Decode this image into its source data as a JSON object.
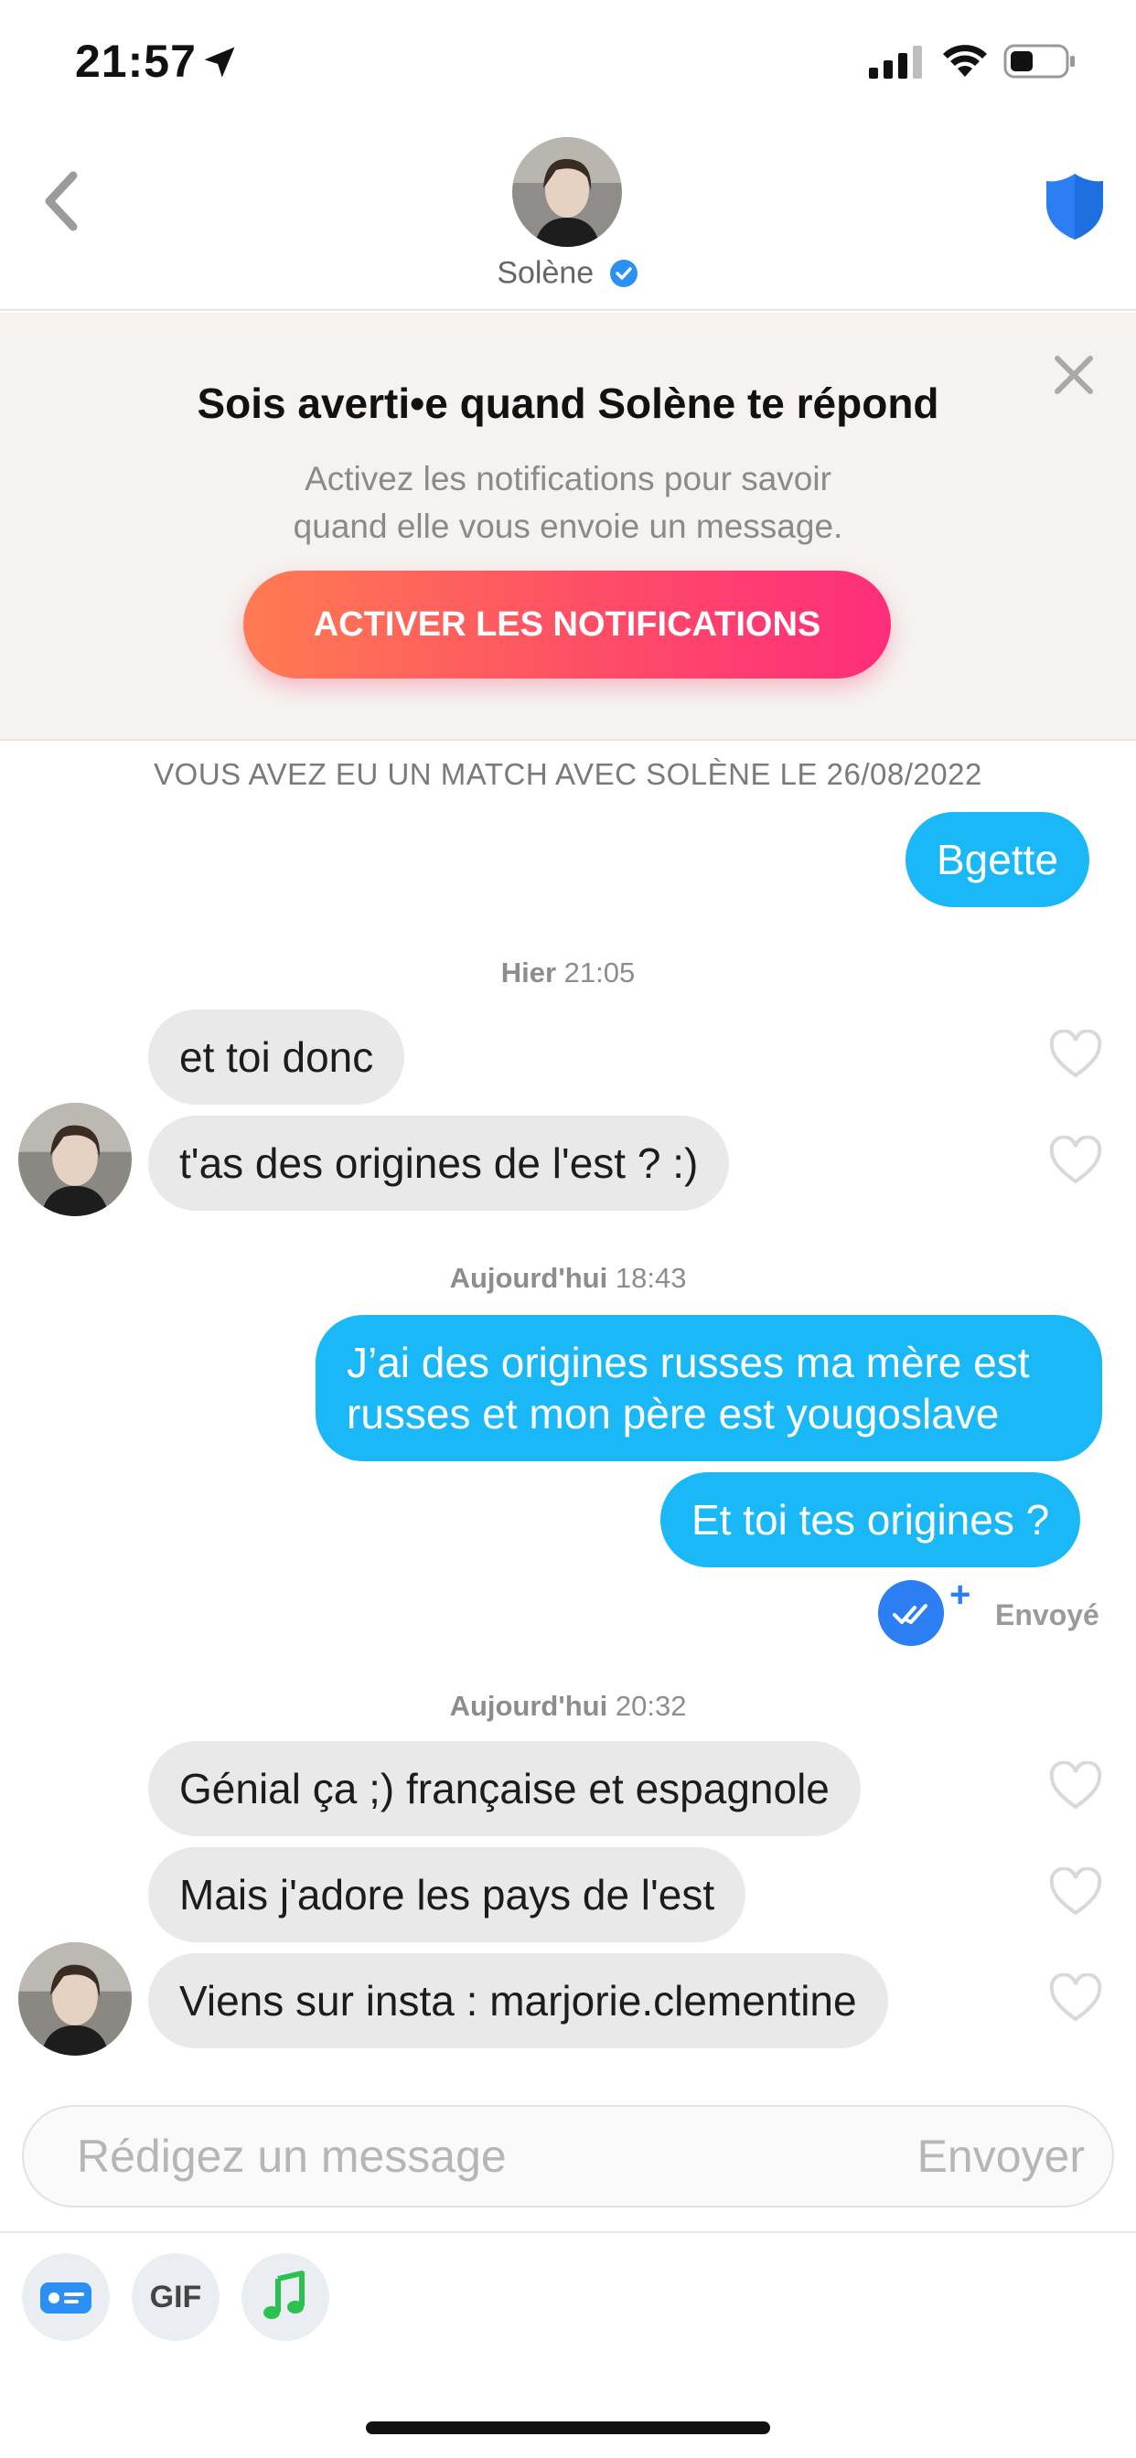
{
  "status_bar": {
    "time": "21:57"
  },
  "header": {
    "contact_name": "Solène"
  },
  "banner": {
    "title": "Sois averti•e quand Solène te répond",
    "subtitle_line1": "Activez les notifications pour savoir",
    "subtitle_line2": "quand elle vous envoie un message.",
    "button_label": "ACTIVER LES NOTIFICATIONS"
  },
  "chat": {
    "match_info": "VOUS AVEZ EU UN MATCH AVEC SOLÈNE LE 26/08/2022",
    "separators": [
      {
        "day": "Hier",
        "time": "21:05"
      },
      {
        "day": "Aujourd'hui",
        "time": "18:43"
      },
      {
        "day": "Aujourd'hui",
        "time": "20:32"
      }
    ],
    "messages": [
      {
        "from": "me",
        "text": "Bgette"
      },
      {
        "from": "them",
        "text": "et toi donc"
      },
      {
        "from": "them",
        "text": "t'as des origines de l'est ? :)"
      },
      {
        "from": "me",
        "text_line1": "J’ai des origines russes ma mère est",
        "text_line2": "russes et mon père est yougoslave"
      },
      {
        "from": "me",
        "text": "Et toi tes origines ?"
      },
      {
        "from": "them",
        "text": "Génial ça ;) française et espagnole"
      },
      {
        "from": "them",
        "text": "Mais j'adore les pays de l'est"
      },
      {
        "from": "them",
        "text": "Viens sur insta : marjorie.clementine"
      }
    ],
    "sent_status": "Envoyé"
  },
  "composer": {
    "placeholder": "Rédigez un message",
    "send_label": "Envoyer"
  },
  "toolbar": {
    "gif_label": "GIF"
  },
  "colors": {
    "my_bubble": "#1ab8f7",
    "their_bubble": "#e9e9e9",
    "shield": "#2b7ff3",
    "button_gradient_start": "#ff7b51",
    "button_gradient_end": "#fd2d7b"
  },
  "icons": [
    "location-arrow-icon",
    "signal-icon",
    "wifi-icon",
    "battery-icon",
    "back-chevron-icon",
    "verified-badge-icon",
    "shield-icon",
    "close-icon",
    "heart-icon",
    "double-check-icon",
    "contact-card-icon",
    "music-note-icon"
  ]
}
